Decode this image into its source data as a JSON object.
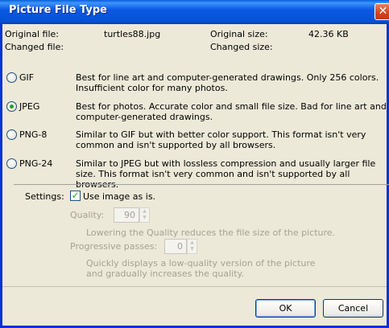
{
  "window": {
    "title": "Picture File Type",
    "close_glyph": "✕"
  },
  "info": {
    "original_file_label": "Original file:",
    "original_file_value": "turtles88.jpg",
    "changed_file_label": "Changed file:",
    "original_size_label": "Original size:",
    "original_size_value": "42.36 KB",
    "changed_size_label": "Changed size:"
  },
  "formats": [
    {
      "label": "GIF",
      "checked": false,
      "desc": "Best for line art and computer-generated drawings.  Only 256 colors. Insufficient color for many photos."
    },
    {
      "label": "JPEG",
      "checked": true,
      "desc": "Best for photos.  Accurate color and small file size. Bad for line art and computer-generated drawings."
    },
    {
      "label": "PNG-8",
      "checked": false,
      "desc": "Similar to GIF but with better color support.   This format isn't very common and isn't supported by all browsers."
    },
    {
      "label": "PNG-24",
      "checked": false,
      "desc": "Similar to JPEG but with lossless compression and usually larger file size.  This format isn't very common and isn't supported by all browsers."
    }
  ],
  "settings": {
    "label": "Settings:",
    "use_image_label": "Use image as is.",
    "use_image_checked": true,
    "quality_label": "Quality:",
    "quality_value": "90",
    "quality_hint": "Lowering the Quality reduces the file size of the picture.",
    "progressive_label": "Progressive passes:",
    "progressive_value": "0",
    "progressive_hint": "Quickly displays a low-quality version of the picture and gradually increases the quality."
  },
  "buttons": {
    "ok": "OK",
    "cancel": "Cancel"
  },
  "colors": {
    "title_bar": "#0652d6",
    "close_button": "#d4481e",
    "dialog_bg": "#ece9d8",
    "radio_dot": "#21a121",
    "disabled_text": "#a3a295"
  }
}
